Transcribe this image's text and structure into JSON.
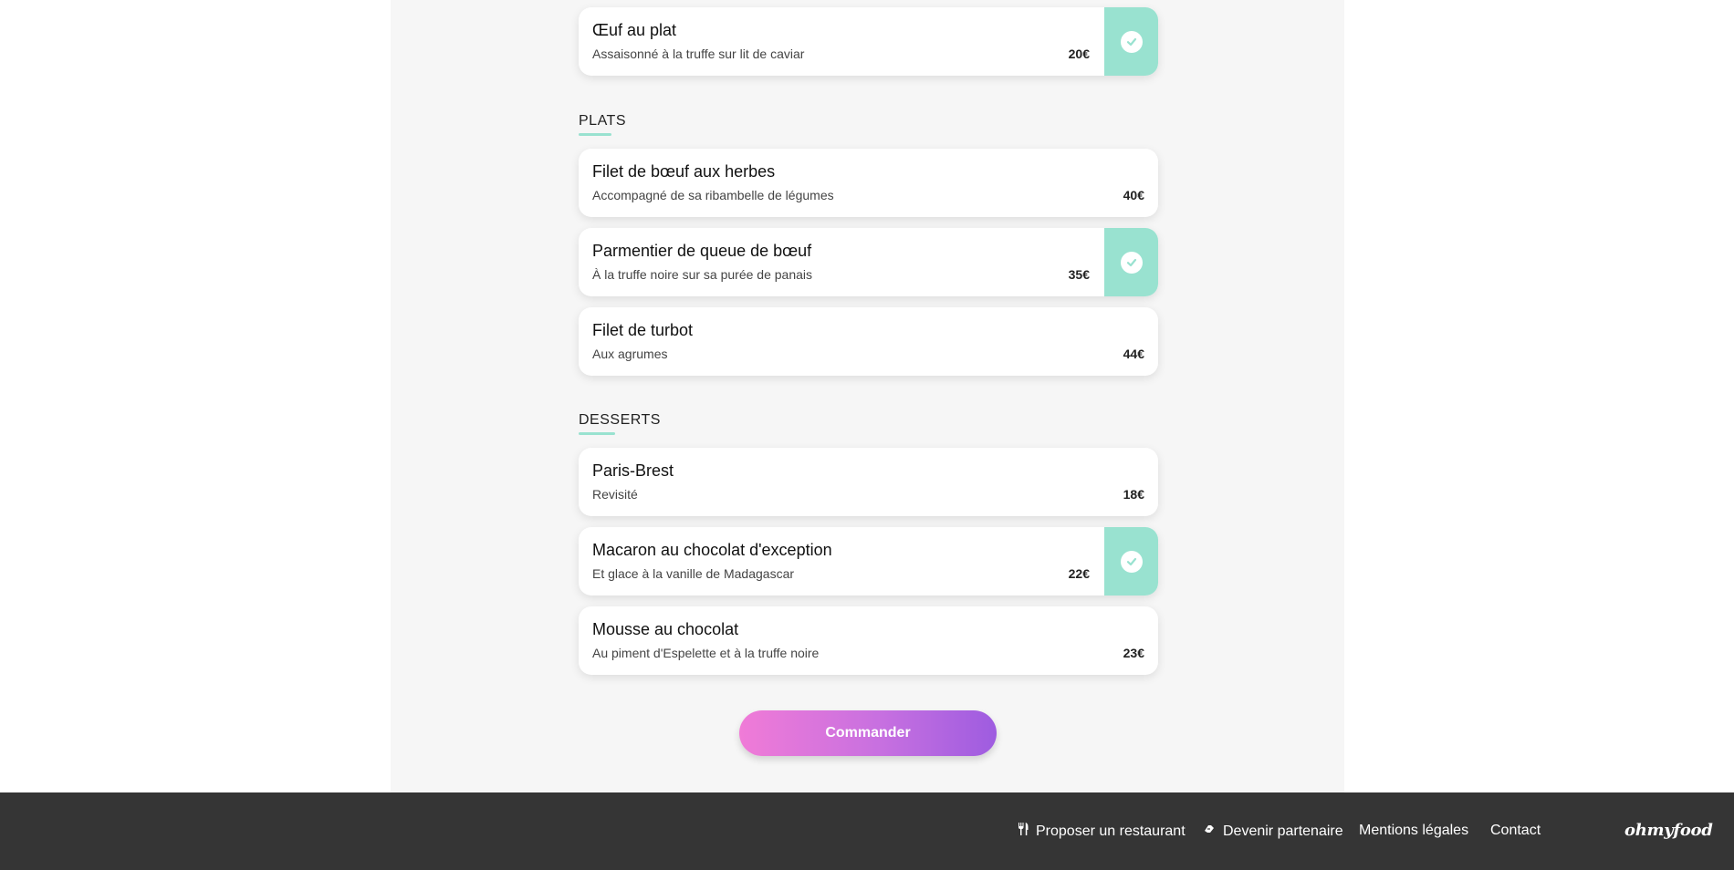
{
  "sections": {
    "plats_title": "PLATS",
    "desserts_title": "DESSERTS"
  },
  "dishes": [
    {
      "name": "Œuf au plat",
      "description": "Assaisonné à la truffe sur lit de caviar",
      "price": "20€",
      "selected": true
    },
    {
      "name": "Filet de bœuf aux herbes",
      "description": "Accompagné de sa ribambelle de légumes",
      "price": "40€",
      "selected": false
    },
    {
      "name": "Parmentier de queue de bœuf",
      "description": "À la truffe noire sur sa purée de panais",
      "price": "35€",
      "selected": true
    },
    {
      "name": "Filet de turbot",
      "description": "Aux agrumes",
      "price": "44€",
      "selected": false
    },
    {
      "name": "Paris-Brest",
      "description": "Revisité",
      "price": "18€",
      "selected": false
    },
    {
      "name": "Macaron au chocolat d'exception",
      "description": "Et glace à la vanille de Madagascar",
      "price": "22€",
      "selected": true
    },
    {
      "name": "Mousse au chocolat",
      "description": "Au piment d'Espelette et à la truffe noire",
      "price": "23€",
      "selected": false
    }
  ],
  "order_button": "Commander",
  "footer": {
    "links": [
      {
        "label": "Proposer un restaurant",
        "icon": "utensils-icon"
      },
      {
        "label": "Devenir partenaire",
        "icon": "handshake-icon"
      },
      {
        "label": "Mentions légales"
      },
      {
        "label": "Contact"
      }
    ],
    "logo": "ohmyfood"
  },
  "colors": {
    "accent_mint": "#99e2d0",
    "button_gradient_start": "#f07bd7",
    "button_gradient_end": "#9e5ce0",
    "footer_bg": "#353535",
    "main_bg": "#f6f6f6"
  }
}
